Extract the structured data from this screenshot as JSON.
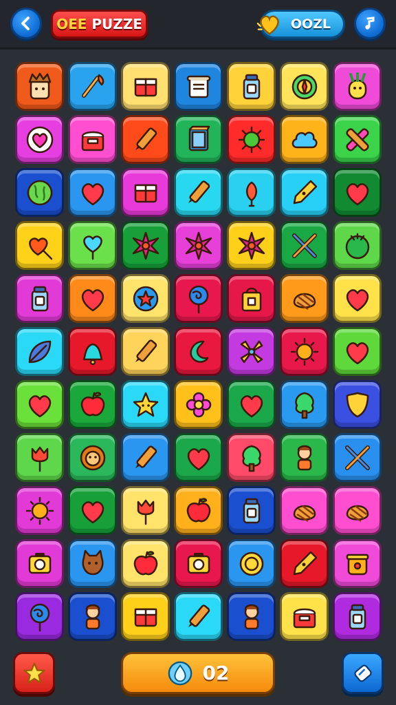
{
  "header": {
    "back_icon": "chevron-left-icon",
    "title_first": "OEE",
    "title_rest": " PUZZE",
    "coins": "OOZL",
    "coin_icon": "gold-heart-icon",
    "music_icon": "music-note-icon"
  },
  "footer": {
    "star_icon": "star-icon",
    "moves_icon": "water-drop-icon",
    "moves_count": "02",
    "action_icon": "eraser-icon"
  },
  "board": {
    "columns": 7,
    "rows": 11,
    "tiles": [
      {
        "color": "#f05a1a",
        "icon": "crown-face-icon"
      },
      {
        "color": "#2aa3ef",
        "icon": "brush-icon"
      },
      {
        "color": "#ffe071",
        "icon": "gift-box-icon"
      },
      {
        "color": "#1f86e0",
        "icon": "scroll-icon"
      },
      {
        "color": "#ffd23a",
        "icon": "jar-icon"
      },
      {
        "color": "#ffe35a",
        "icon": "compass-icon"
      },
      {
        "color": "#f04ad8",
        "icon": "pineapple-icon"
      },
      {
        "color": "#e63ee0",
        "icon": "heart-badge-icon"
      },
      {
        "color": "#ff4fd0",
        "icon": "cake-icon"
      },
      {
        "color": "#ff4a1a",
        "icon": "pencil-icon"
      },
      {
        "color": "#22b458",
        "icon": "book-icon"
      },
      {
        "color": "#ff2a2a",
        "icon": "virus-icon"
      },
      {
        "color": "#ffb31a",
        "icon": "cloud-icon"
      },
      {
        "color": "#3ad34a",
        "icon": "cross-bandage-icon"
      },
      {
        "color": "#1a4fd0",
        "icon": "globe-icon"
      },
      {
        "color": "#2a96f0",
        "icon": "heart-icon"
      },
      {
        "color": "#e83ad8",
        "icon": "gift-box-icon"
      },
      {
        "color": "#28d8f0",
        "icon": "pencil-icon"
      },
      {
        "color": "#2ad0f0",
        "icon": "lantern-icon"
      },
      {
        "color": "#28d0f8",
        "icon": "pen-nib-icon"
      },
      {
        "color": "#118a32",
        "icon": "heart-icon"
      },
      {
        "color": "#ffd21a",
        "icon": "heart-arrow-icon"
      },
      {
        "color": "#6ae04a",
        "icon": "heart-balloon-icon"
      },
      {
        "color": "#17a03a",
        "icon": "star-flower-icon"
      },
      {
        "color": "#e640d8",
        "icon": "star-flower-icon"
      },
      {
        "color": "#ffd01a",
        "icon": "star-flower-icon"
      },
      {
        "color": "#1aa845",
        "icon": "crossed-tools-icon"
      },
      {
        "color": "#5ed84a",
        "icon": "melon-icon"
      },
      {
        "color": "#e23ad6",
        "icon": "jar-icon"
      },
      {
        "color": "#ff8a1a",
        "icon": "heart-icon"
      },
      {
        "color": "#ffe36a",
        "icon": "badge-icon"
      },
      {
        "color": "#e8184e",
        "icon": "lollipop-icon"
      },
      {
        "color": "#e6184a",
        "icon": "bag-icon"
      },
      {
        "color": "#ff9a1a",
        "icon": "shell-icon"
      },
      {
        "color": "#ffe24a",
        "icon": "heart-icon"
      },
      {
        "color": "#2ad8f8",
        "icon": "leaf-icon"
      },
      {
        "color": "#e6182a",
        "icon": "bell-icon"
      },
      {
        "color": "#ffd45a",
        "icon": "pencil-icon"
      },
      {
        "color": "#e8183e",
        "icon": "moon-icon"
      },
      {
        "color": "#c23ae0",
        "icon": "windmill-icon"
      },
      {
        "color": "#e8184a",
        "icon": "sun-icon"
      },
      {
        "color": "#5ed83a",
        "icon": "heart-icon"
      },
      {
        "color": "#6ae03a",
        "icon": "heart-icon"
      },
      {
        "color": "#1aa83a",
        "icon": "apple-icon"
      },
      {
        "color": "#2ad8f8",
        "icon": "star-face-icon"
      },
      {
        "color": "#ffc01a",
        "icon": "flower-icon"
      },
      {
        "color": "#1aa84a",
        "icon": "heart-icon"
      },
      {
        "color": "#2a9af0",
        "icon": "tree-icon"
      },
      {
        "color": "#3a50e0",
        "icon": "shield-icon"
      },
      {
        "color": "#5ed84a",
        "icon": "tulip-icon"
      },
      {
        "color": "#2ab85a",
        "icon": "lion-icon"
      },
      {
        "color": "#2a96f0",
        "icon": "pencil-icon"
      },
      {
        "color": "#1aa84a",
        "icon": "heart-icon"
      },
      {
        "color": "#ff4a6a",
        "icon": "tree-icon"
      },
      {
        "color": "#2ab84a",
        "icon": "doll-icon"
      },
      {
        "color": "#2a90f0",
        "icon": "crossed-tools-icon"
      },
      {
        "color": "#e23ad6",
        "icon": "sun-icon"
      },
      {
        "color": "#17a03a",
        "icon": "heart-icon"
      },
      {
        "color": "#ffe36a",
        "icon": "tulip-icon"
      },
      {
        "color": "#ffb01a",
        "icon": "apple-icon"
      },
      {
        "color": "#1a4fd0",
        "icon": "jar-icon"
      },
      {
        "color": "#ff4fd0",
        "icon": "shell-icon"
      },
      {
        "color": "#ff4fd0",
        "icon": "shell-icon"
      },
      {
        "color": "#e23ad6",
        "icon": "camera-icon"
      },
      {
        "color": "#2a96f0",
        "icon": "cat-icon"
      },
      {
        "color": "#ffe36a",
        "icon": "apple-icon"
      },
      {
        "color": "#e8184e",
        "icon": "camera-icon"
      },
      {
        "color": "#2a96f0",
        "icon": "coin-icon"
      },
      {
        "color": "#e6182a",
        "icon": "pen-nib-icon"
      },
      {
        "color": "#f04ad8",
        "icon": "pot-icon"
      },
      {
        "color": "#9a2ae0",
        "icon": "lollipop-icon"
      },
      {
        "color": "#1a4fd0",
        "icon": "doll-icon"
      },
      {
        "color": "#ffd01a",
        "icon": "gift-box-icon"
      },
      {
        "color": "#2ad8f8",
        "icon": "pencil-icon"
      },
      {
        "color": "#1a4fd0",
        "icon": "doll-icon"
      },
      {
        "color": "#ffe24a",
        "icon": "cake-icon"
      },
      {
        "color": "#b02ae0",
        "icon": "jar-icon"
      }
    ]
  }
}
